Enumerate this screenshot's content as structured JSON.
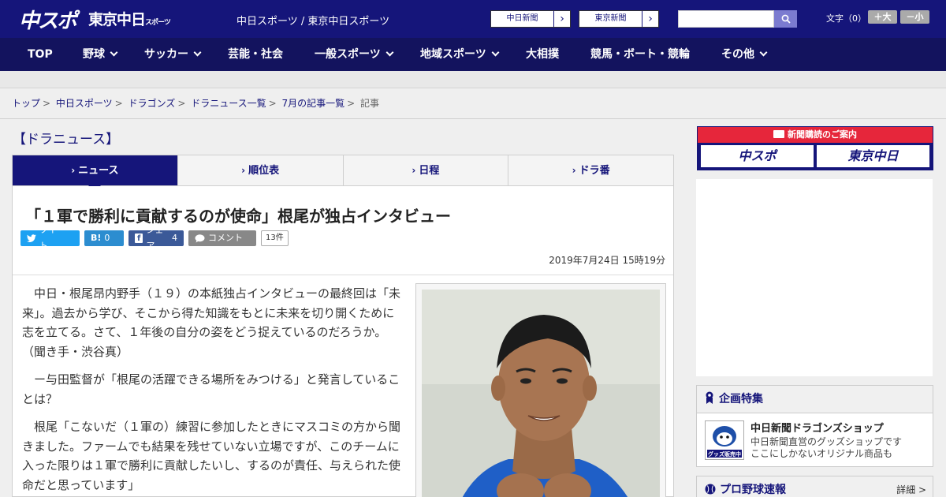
{
  "header": {
    "logo_main": "中スポ",
    "logo_tokyo": "東京中日",
    "logo_tokyo_sub": "スポーツ",
    "site_title": "中日スポーツ / 東京中日スポーツ",
    "paper_links": [
      {
        "label": "中日新聞"
      },
      {
        "label": "東京新聞"
      }
    ],
    "search_placeholder": "",
    "font_size_label": "文字（0）",
    "font_larger": "＋大",
    "font_smaller": "－小"
  },
  "nav": {
    "items": [
      {
        "label": "TOP",
        "has_menu": false
      },
      {
        "label": "野球",
        "has_menu": true
      },
      {
        "label": "サッカー",
        "has_menu": true
      },
      {
        "label": "芸能・社会",
        "has_menu": false
      },
      {
        "label": "一般スポーツ",
        "has_menu": true
      },
      {
        "label": "地域スポーツ",
        "has_menu": true
      },
      {
        "label": "大相撲",
        "has_menu": false
      },
      {
        "label": "競馬・ボート・競輪",
        "has_menu": false
      },
      {
        "label": "その他",
        "has_menu": true
      }
    ]
  },
  "breadcrumb": {
    "items": [
      "トップ",
      "中日スポーツ",
      "ドラゴンズ",
      "ドラニュース一覧",
      "7月の記事一覧"
    ],
    "current": "記事"
  },
  "section_title": "【ドラニュース】",
  "tabs": [
    {
      "label": "ニュース",
      "active": true
    },
    {
      "label": "順位表",
      "active": false
    },
    {
      "label": "日程",
      "active": false
    },
    {
      "label": "ドラ番",
      "active": false
    }
  ],
  "article": {
    "headline": "「１軍で勝利に貢献するのが使命」根尾が独占インタビュー",
    "share": {
      "tweet": "ツイート",
      "hatena_label": "B!",
      "hatena_count": "0",
      "facebook": "シェア",
      "facebook_count": "4",
      "comment": "コメント",
      "comment_count": "13件"
    },
    "date": "2019年7月24日 15時19分",
    "paragraphs": [
      "中日・根尾昂内野手（１９）の本紙独占インタビューの最終回は「未来」。過去から学び、そこから得た知識をもとに未来を切り開くために志を立てる。さて、１年後の自分の姿をどう捉えているのだろうか。　（聞き手・渋谷真）",
      "ー与田監督が「根尾の活躍できる場所をみつける」と発言していることは？",
      "根尾「こないだ（１軍の）練習に参加したときにマスコミの方から聞きました。ファームでも結果を残せていない立場ですが、このチームに入った限りは１軍で勝利に貢献したいし、するのが責任、与えられた使命だと思っています」"
    ]
  },
  "sidebar": {
    "subscription": {
      "heading": "新聞購読のご案内",
      "logo_main": "中スポ",
      "logo_tokyo": "東京中日"
    },
    "feature": {
      "heading": "企画特集",
      "shop_title": "中日新聞ドラゴンズショップ",
      "shop_desc_1": "中日新聞直営のグッズショップです",
      "shop_desc_2": "ここにしかないオリジナル商品も",
      "shop_thumb_text": "グッズ販売中"
    },
    "baseball": {
      "heading": "プロ野球速報",
      "detail": "詳細 >"
    }
  },
  "colors": {
    "brand_navy": "#15157a",
    "nav_navy": "#13135e",
    "twitter": "#1da1f2",
    "hatena": "#2c8dd0",
    "facebook": "#3b5998",
    "subscription_red": "#e6263b"
  }
}
